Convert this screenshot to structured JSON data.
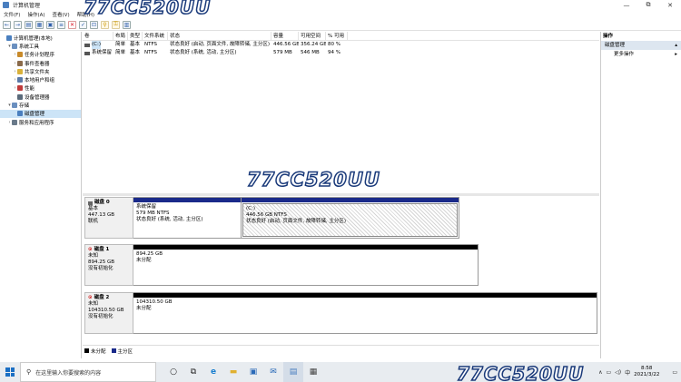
{
  "window": {
    "title": "计算机管理",
    "controls": [
      "—",
      "⧉",
      "✕"
    ]
  },
  "menu": [
    "文件(F)",
    "操作(A)",
    "查看(V)",
    "帮助(H)"
  ],
  "watermark": "77CC520UU",
  "tree": [
    {
      "label": "计算机管理(本地)",
      "twisty": "",
      "color": "#4a7fbf",
      "depth": 0
    },
    {
      "label": "系统工具",
      "twisty": "▾",
      "color": "#6a8fbf",
      "depth": 1
    },
    {
      "label": "任务计划程序",
      "twisty": "›",
      "color": "#c88a2a",
      "depth": 2
    },
    {
      "label": "事件查看器",
      "twisty": "›",
      "color": "#8a6a4a",
      "depth": 2
    },
    {
      "label": "共享文件夹",
      "twisty": "›",
      "color": "#d9b13a",
      "depth": 2
    },
    {
      "label": "本地用户和组",
      "twisty": "›",
      "color": "#5a7aa8",
      "depth": 2
    },
    {
      "label": "性能",
      "twisty": "›",
      "color": "#c03a3a",
      "depth": 2
    },
    {
      "label": "设备管理器",
      "twisty": "",
      "color": "#5a6a7a",
      "depth": 2
    },
    {
      "label": "存储",
      "twisty": "▾",
      "color": "#6a8fbf",
      "depth": 1
    },
    {
      "label": "磁盘管理",
      "twisty": "",
      "color": "#4a7fbf",
      "depth": 2,
      "selected": true
    },
    {
      "label": "服务和应用程序",
      "twisty": "›",
      "color": "#6a7a8a",
      "depth": 1
    }
  ],
  "volume_table": {
    "headers": [
      "卷",
      "布局",
      "类型",
      "文件系统",
      "状态",
      "容量",
      "可用空间",
      "% 可用"
    ],
    "rows": [
      [
        "(C:)",
        "简单",
        "基本",
        "NTFS",
        "状态良好 (启动, 页面文件, 故障转储, 主分区)",
        "446.56 GB",
        "356.24 GB",
        "80 %"
      ],
      [
        "系统保留",
        "简单",
        "基本",
        "NTFS",
        "状态良好 (系统, 活动, 主分区)",
        "579 MB",
        "546 MB",
        "94 %"
      ]
    ]
  },
  "disks": [
    {
      "name": "磁盘 0",
      "type": "基本",
      "size": "447.13 GB",
      "status": "联机",
      "offline": false,
      "partitions": [
        {
          "title": "系统保留",
          "line1": "579 MB NTFS",
          "line2": "状态良好 (系统, 活动, 主分区)",
          "bar": "#1a2a8a",
          "hatched": false,
          "share": 0.22
        },
        {
          "title": "(C:)",
          "line1": "446.56 GB NTFS",
          "line2": "状态良好 (启动, 页面文件, 故障转储, 主分区)",
          "bar": "#1a2a8a",
          "hatched": true,
          "share": 0.78
        }
      ]
    },
    {
      "name": "磁盘 1",
      "type": "未知",
      "size": "894.25 GB",
      "status": "没有初始化",
      "offline": true,
      "partitions": [
        {
          "title": "",
          "line1": "894.25 GB",
          "line2": "未分配",
          "bar": "#000000",
          "hatched": false,
          "share": 1
        }
      ]
    },
    {
      "name": "磁盘 2",
      "type": "未知",
      "size": "104310.50 GB",
      "status": "没有初始化",
      "offline": true,
      "partitions": [
        {
          "title": "",
          "line1": "104310.50 GB",
          "line2": "未分配",
          "bar": "#000000",
          "hatched": false,
          "share": 1
        }
      ]
    }
  ],
  "legend": [
    {
      "label": "未分配",
      "color": "#000000"
    },
    {
      "label": "主分区",
      "color": "#1a2a8a"
    }
  ],
  "actions": {
    "header": "操作",
    "section": "磁盘管理",
    "item": "更多操作",
    "section_arrow": "▴",
    "item_arrow": "▸"
  },
  "taskbar": {
    "search_placeholder": "在这里输入你要搜索的内容",
    "tray_chevron": "∧",
    "tray_lang": "中",
    "time": "8:58",
    "date": "2021/3/22"
  }
}
